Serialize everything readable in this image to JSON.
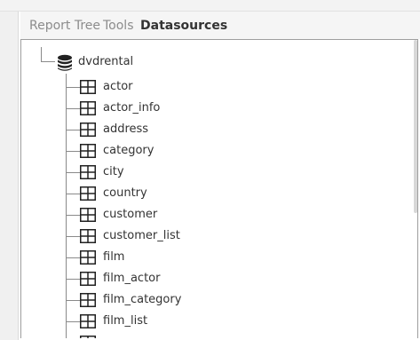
{
  "tabs": [
    {
      "label": "Report Tree",
      "active": false
    },
    {
      "label": "Tools",
      "active": false
    },
    {
      "label": "Datasources",
      "active": true
    }
  ],
  "tree": {
    "root": {
      "label": "dvdrental",
      "icon": "database-icon"
    },
    "tables": [
      {
        "label": "actor",
        "icon": "table-icon"
      },
      {
        "label": "actor_info",
        "icon": "table-icon"
      },
      {
        "label": "address",
        "icon": "table-icon"
      },
      {
        "label": "category",
        "icon": "table-icon"
      },
      {
        "label": "city",
        "icon": "table-icon"
      },
      {
        "label": "country",
        "icon": "table-icon"
      },
      {
        "label": "customer",
        "icon": "table-icon"
      },
      {
        "label": "customer_list",
        "icon": "table-icon"
      },
      {
        "label": "film",
        "icon": "table-icon"
      },
      {
        "label": "film_actor",
        "icon": "table-icon"
      },
      {
        "label": "film_category",
        "icon": "table-icon"
      },
      {
        "label": "film_list",
        "icon": "table-icon"
      },
      {
        "label": "",
        "icon": "table-icon"
      }
    ]
  },
  "colors": {
    "active_tab": "#333333",
    "inactive_tab": "#8c8c8c",
    "tree_line": "#8a8a8a",
    "icon": "#222222"
  }
}
